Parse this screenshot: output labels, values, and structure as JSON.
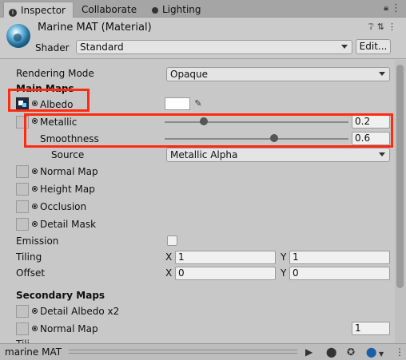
{
  "tabs": [
    {
      "label": "Inspector",
      "icon": "info-icon"
    },
    {
      "label": "Collaborate"
    },
    {
      "label": "Lighting",
      "icon": "bulb-icon"
    }
  ],
  "header": {
    "title": "Marine MAT (Material)",
    "shader_label": "Shader",
    "shader_value": "Standard",
    "edit_label": "Edit...",
    "icons": [
      "help-icon",
      "preset-icon",
      "kebab-icon"
    ]
  },
  "rendering_mode": {
    "label": "Rendering Mode",
    "value": "Opaque"
  },
  "main_maps": {
    "heading": "Main Maps",
    "albedo": {
      "label": "Albedo",
      "color": "#ffffff"
    },
    "metallic": {
      "label": "Metallic",
      "value": "0.2",
      "fraction": 0.2
    },
    "smoothness": {
      "label": "Smoothness",
      "value": "0.6",
      "fraction": 0.6
    },
    "source": {
      "label": "Source",
      "value": "Metallic Alpha"
    },
    "normal_map": {
      "label": "Normal Map"
    },
    "height_map": {
      "label": "Height Map"
    },
    "occlusion": {
      "label": "Occlusion"
    },
    "detail_mask": {
      "label": "Detail Mask"
    },
    "emission": {
      "label": "Emission",
      "checked": false
    },
    "tiling": {
      "label": "Tiling",
      "x_label": "X",
      "x": "1",
      "y_label": "Y",
      "y": "1"
    },
    "offset": {
      "label": "Offset",
      "x_label": "X",
      "x": "0",
      "y_label": "Y",
      "y": "0"
    }
  },
  "secondary_maps": {
    "heading": "Secondary Maps",
    "detail_albedo": {
      "label": "Detail Albedo x2"
    },
    "normal_map": {
      "label": "Normal Map",
      "value": "1"
    },
    "tiling_partial": "Tili"
  },
  "bottom_bar": {
    "title": "marine MAT"
  },
  "colors": {
    "highlight": "#ff2a12",
    "panel": "#c8c8c8",
    "tabbar": "#a5a5a5"
  }
}
